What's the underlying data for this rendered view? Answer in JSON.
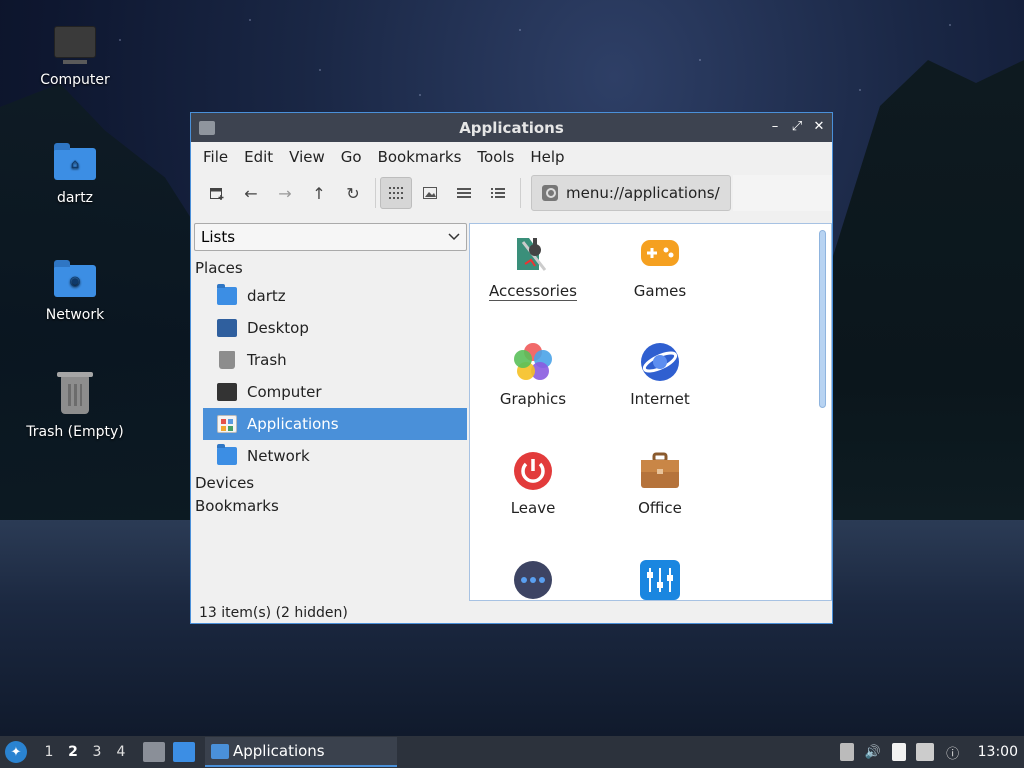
{
  "desktop": {
    "icons": [
      {
        "label": "Computer"
      },
      {
        "label": "dartz"
      },
      {
        "label": "Network"
      },
      {
        "label": "Trash (Empty)"
      }
    ]
  },
  "window": {
    "title": "Applications",
    "controls": {
      "minimize": "–",
      "maximize": "⤢",
      "close": "✕"
    }
  },
  "menubar": [
    "File",
    "Edit",
    "View",
    "Go",
    "Bookmarks",
    "Tools",
    "Help"
  ],
  "toolbar": {
    "path": "menu://applications/"
  },
  "sidebar": {
    "mode": "Lists",
    "places_header": "Places",
    "places": [
      {
        "label": "dartz",
        "icon": "home-folder-icon"
      },
      {
        "label": "Desktop",
        "icon": "desktop-icon"
      },
      {
        "label": "Trash",
        "icon": "trash-icon"
      },
      {
        "label": "Computer",
        "icon": "computer-icon"
      },
      {
        "label": "Applications",
        "icon": "applications-icon",
        "selected": true
      },
      {
        "label": "Network",
        "icon": "network-folder-icon"
      }
    ],
    "devices_header": "Devices",
    "bookmarks_header": "Bookmarks"
  },
  "content": {
    "items": [
      {
        "label": "Accessories",
        "icon": "accessories-icon"
      },
      {
        "label": "Games",
        "icon": "games-icon"
      },
      {
        "label": "Graphics",
        "icon": "graphics-icon"
      },
      {
        "label": "Internet",
        "icon": "internet-icon"
      },
      {
        "label": "Leave",
        "icon": "leave-icon"
      },
      {
        "label": "Office",
        "icon": "office-icon"
      },
      {
        "label": "",
        "icon": "other-icon"
      },
      {
        "label": "",
        "icon": "settings-icon"
      }
    ]
  },
  "status": "13 item(s) (2 hidden)",
  "taskbar": {
    "workspaces": [
      "1",
      "2",
      "3",
      "4"
    ],
    "current_workspace": "2",
    "task_label": "Applications",
    "clock": "13:00"
  },
  "colors": {
    "accent": "#4a90d9",
    "titlebar": "#3d4350",
    "taskbar": "#2c323c"
  }
}
